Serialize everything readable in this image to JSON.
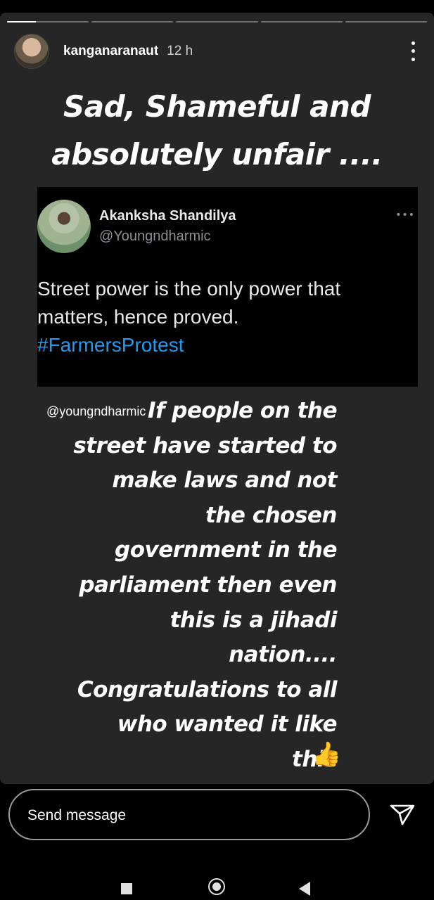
{
  "story": {
    "progress": [
      1,
      0,
      0,
      0,
      0
    ],
    "username": "kanganaranaut",
    "time": "12 h",
    "headline_line1": "Sad, Shameful and",
    "headline_line2": "absolutely unfair ...."
  },
  "tweet": {
    "name": "Akanksha Shandilya",
    "handle": "@Youngndharmic",
    "more": "•••",
    "text_line1": "Street power is the only power that",
    "text_line2": "matters, hence proved.",
    "hashtag": "#FarmersProtest"
  },
  "watermark": "@youngndharmic",
  "body_lines": [
    "If people on the",
    "street have started to",
    "make laws and not",
    "the chosen",
    "government in the",
    "parliament then even",
    "this is a jihadi",
    "nation....",
    "Congratulations to all",
    "who wanted it like",
    "this"
  ],
  "emoji": "👍",
  "message_bar": {
    "placeholder": "Send message"
  },
  "icons": {
    "send": "send-icon",
    "more": "more-vertical-icon"
  },
  "colors": {
    "hashtag": "#1d9bf0",
    "story_bg": "#262626",
    "tweet_bg": "#000000"
  }
}
